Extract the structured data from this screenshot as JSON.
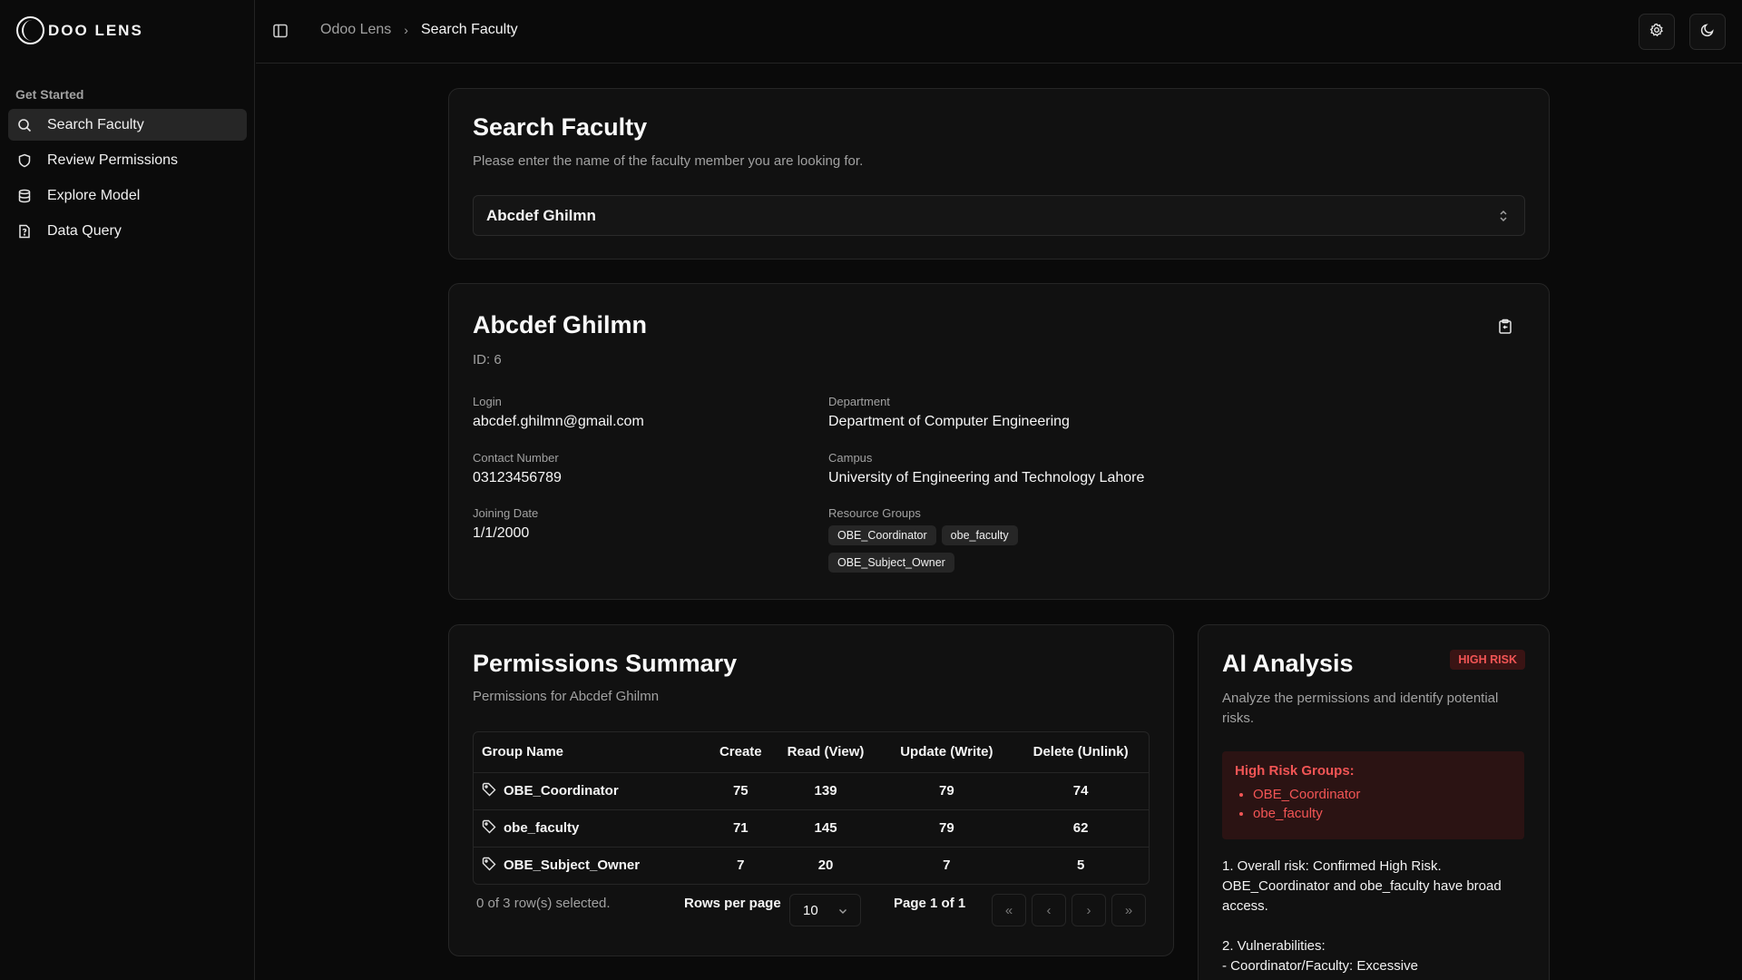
{
  "app": {
    "logo_text": "DOO LENS"
  },
  "sidebar": {
    "section_label": "Get Started",
    "items": [
      {
        "label": "Search Faculty",
        "icon": "search-icon",
        "active": true
      },
      {
        "label": "Review Permissions",
        "icon": "shield-icon",
        "active": false
      },
      {
        "label": "Explore Model",
        "icon": "database-icon",
        "active": false
      },
      {
        "label": "Data Query",
        "icon": "file-question-icon",
        "active": false
      }
    ]
  },
  "header": {
    "breadcrumb_root": "Odoo Lens",
    "breadcrumb_current": "Search Faculty"
  },
  "search_card": {
    "title": "Search Faculty",
    "description": "Please enter the name of the faculty member you are looking for.",
    "selected_value": "Abcdef Ghilmn"
  },
  "profile": {
    "name": "Abcdef Ghilmn",
    "id_text": "ID: 6",
    "login_label": "Login",
    "login": "abcdef.ghilmn@gmail.com",
    "contact_label": "Contact Number",
    "contact": "03123456789",
    "joining_label": "Joining Date",
    "joining": "1/1/2000",
    "department_label": "Department",
    "department": "Department of Computer Engineering",
    "campus_label": "Campus",
    "campus": "University of Engineering and Technology Lahore",
    "groups_label": "Resource Groups",
    "groups": [
      "OBE_Coordinator",
      "obe_faculty",
      "OBE_Subject_Owner"
    ]
  },
  "permissions": {
    "title": "Permissions Summary",
    "subtitle": "Permissions for Abcdef Ghilmn",
    "columns": [
      "Group Name",
      "Create",
      "Read (View)",
      "Update (Write)",
      "Delete (Unlink)"
    ],
    "rows": [
      [
        "OBE_Coordinator",
        "75",
        "139",
        "79",
        "74"
      ],
      [
        "obe_faculty",
        "71",
        "145",
        "79",
        "62"
      ],
      [
        "OBE_Subject_Owner",
        "7",
        "20",
        "7",
        "5"
      ]
    ],
    "selection_text": "0 of 3 row(s) selected.",
    "rows_per_page_label": "Rows per page",
    "rows_per_page": "10",
    "page_text": "Page 1 of 1"
  },
  "ai": {
    "title": "AI Analysis",
    "badge": "HIGH RISK",
    "description": "Analyze the permissions and identify potential risks.",
    "risk_title": "High Risk Groups:",
    "risk_groups": [
      "OBE_Coordinator",
      "obe_faculty"
    ],
    "analysis_1": "1. Overall risk: Confirmed High Risk. OBE_Coordinator and obe_faculty have broad access.",
    "analysis_2": "2. Vulnerabilities:",
    "analysis_3": "- Coordinator/Faculty: Excessive"
  },
  "colors": {
    "accent_danger": "#f25555",
    "background": "#0a0a0a",
    "card": "#111111"
  }
}
